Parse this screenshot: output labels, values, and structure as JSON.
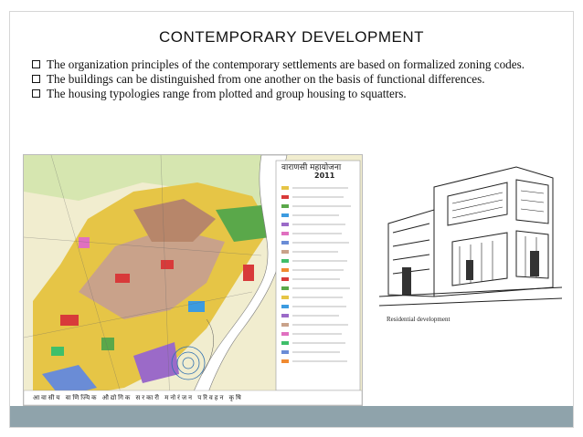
{
  "slide": {
    "title": "CONTEMPORARY DEVELOPMENT",
    "bullets": [
      "The organization principles of the contemporary settlements are based on formalized zoning codes.",
      "The buildings can be distinguished from one another on the basis of functional differences.",
      "The housing typologies range from plotted and group housing to squatters."
    ],
    "map": {
      "legend_title": "वाराणसी महायोजना",
      "legend_year": "2011",
      "footer_text": "आवासीय वाणिज्यिक औद्योगिक सरकारी मनोरंजन परिवहन कृषि"
    },
    "caption": "Residential development",
    "colors": {
      "band": "#8fa3ab",
      "residential": "#e8c840",
      "commercial": "#d83a3a",
      "park": "#5aa84a",
      "river": "#ffffff"
    }
  }
}
